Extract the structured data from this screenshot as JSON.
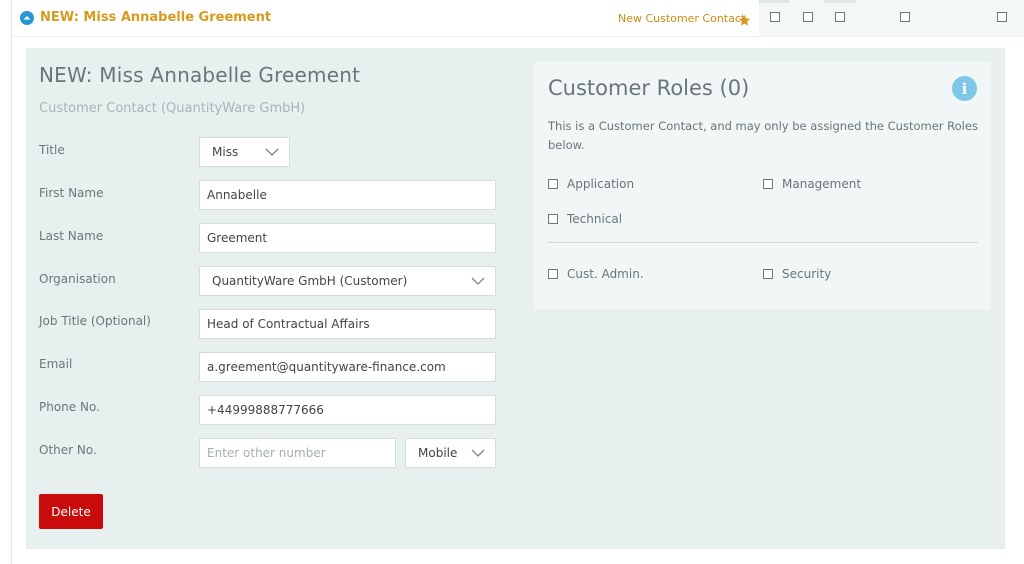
{
  "header": {
    "title": "NEW: Miss Annabelle Greement",
    "record_type_link": "New Customer Contact"
  },
  "form": {
    "title": "NEW: Miss Annabelle Greement",
    "subtitle": "Customer Contact (QuantityWare GmbH)",
    "fields": {
      "title": {
        "label": "Title",
        "value": "Miss"
      },
      "first_name": {
        "label": "First Name",
        "value": "Annabelle"
      },
      "last_name": {
        "label": "Last Name",
        "value": "Greement"
      },
      "organisation": {
        "label": "Organisation",
        "value": "QuantityWare GmbH (Customer)"
      },
      "job_title": {
        "label": "Job Title (Optional)",
        "value": "Head of Contractual Affairs"
      },
      "email": {
        "label": "Email",
        "value": "a.greement@quantityware-finance.com"
      },
      "phone": {
        "label": "Phone No.",
        "value": "+44999888777666"
      },
      "other": {
        "label": "Other No.",
        "placeholder": "Enter other number",
        "type_value": "Mobile"
      }
    },
    "delete_label": "Delete"
  },
  "roles": {
    "title": "Customer Roles (0)",
    "description": "This is a Customer Contact, and may only be assigned the Customer Roles below.",
    "items": [
      {
        "label": "Application",
        "checked": false
      },
      {
        "label": "Management",
        "checked": false
      },
      {
        "label": "Technical",
        "checked": false
      },
      {
        "label": "Cust. Admin.",
        "checked": false
      },
      {
        "label": "Security",
        "checked": false
      }
    ]
  },
  "colors": {
    "accent_orange": "#d89a1c",
    "info_blue": "#7ec7e9",
    "collapse_blue": "#2a95d4",
    "delete_red": "#c90b0b",
    "panel_bg": "#e8efef"
  },
  "icons": {
    "collapse": "collapse-up-icon",
    "star": "star-icon",
    "info": "info-icon",
    "chevron": "chevron-down-icon"
  }
}
